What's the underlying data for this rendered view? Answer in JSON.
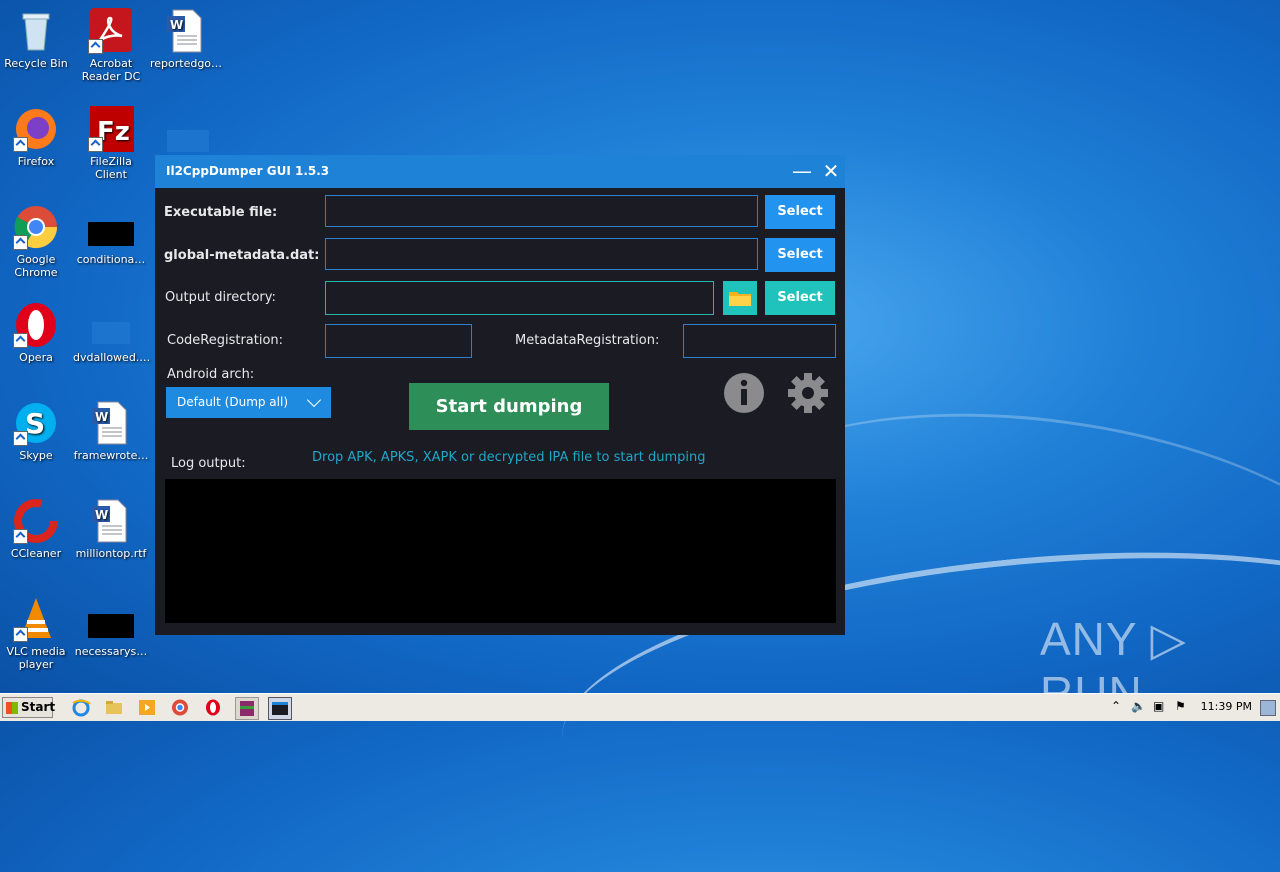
{
  "desktop": {
    "icons": [
      {
        "label": "Recycle Bin"
      },
      {
        "label": "Acrobat Reader DC"
      },
      {
        "label": "reportedgo…"
      },
      {
        "label": "Firefox"
      },
      {
        "label": "FileZilla Client"
      },
      {
        "label": "Google Chrome"
      },
      {
        "label": "conditiona…"
      },
      {
        "label": "Opera"
      },
      {
        "label": "dvdallowed.…"
      },
      {
        "label": "Skype"
      },
      {
        "label": "framewrote…"
      },
      {
        "label": "CCleaner"
      },
      {
        "label": "milliontop.rtf"
      },
      {
        "label": "VLC media player"
      },
      {
        "label": "necessarys…"
      }
    ]
  },
  "window": {
    "title": "Il2CppDumper GUI 1.5.3",
    "minimize_glyph": "—",
    "close_glyph": "✕",
    "executable_label": "Executable file:",
    "metadata_label": "global-metadata.dat:",
    "output_label": "Output directory:",
    "select_label": "Select",
    "code_reg_label": "CodeRegistration:",
    "meta_reg_label": "MetadataRegistration:",
    "arch_label": "Android arch:",
    "arch_value": "Default (Dump all)",
    "start_label": "Start dumping",
    "log_label": "Log output:",
    "hint": "Drop APK, APKS, XAPK or decrypted IPA file to start dumping"
  },
  "taskbar": {
    "start_label": "Start",
    "clock": "11:39 PM"
  },
  "watermark": "ANY ▷ RUN"
}
